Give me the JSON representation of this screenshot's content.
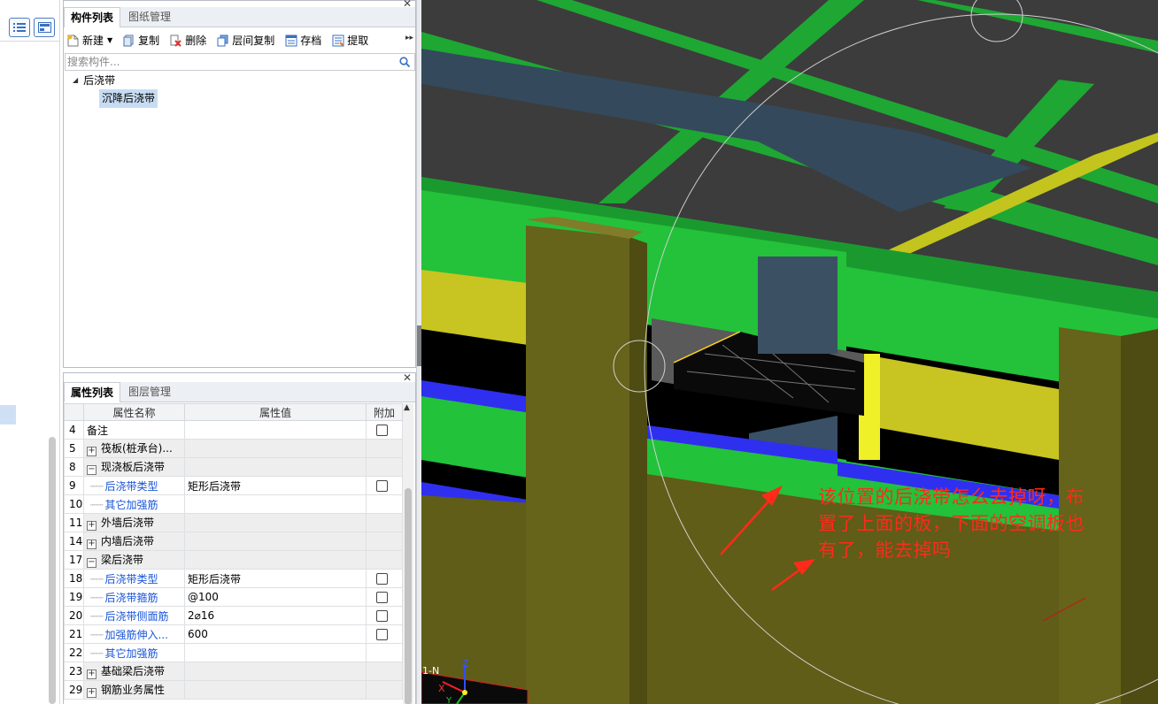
{
  "component_panel": {
    "tabs": [
      "构件列表",
      "图纸管理"
    ],
    "toolbar": {
      "new_label": "新建",
      "copy_label": "复制",
      "delete_label": "删除",
      "floor_copy_label": "层间复制",
      "archive_label": "存档",
      "extract_label": "提取"
    },
    "search_placeholder": "搜索构件...",
    "tree": {
      "root": "后浇带",
      "child": "沉降后浇带"
    }
  },
  "property_panel": {
    "tabs": [
      "属性列表",
      "图层管理"
    ],
    "columns": {
      "name": "属性名称",
      "value": "属性值",
      "extra": "附加"
    },
    "rows": [
      {
        "num": "4",
        "name": "备注",
        "value": "",
        "check": true,
        "level": "top",
        "toggle": ""
      },
      {
        "num": "5",
        "name": "筏板(桩承台)...",
        "value": "",
        "check": false,
        "level": "group",
        "toggle": "+"
      },
      {
        "num": "8",
        "name": "现浇板后浇带",
        "value": "",
        "check": false,
        "level": "group",
        "toggle": "−"
      },
      {
        "num": "9",
        "name": "后浇带类型",
        "value": "矩形后浇带",
        "check": true,
        "level": "sub",
        "toggle": ""
      },
      {
        "num": "10",
        "name": "其它加强筋",
        "value": "",
        "check": false,
        "level": "sub",
        "toggle": ""
      },
      {
        "num": "11",
        "name": "外墙后浇带",
        "value": "",
        "check": false,
        "level": "group",
        "toggle": "+"
      },
      {
        "num": "14",
        "name": "内墙后浇带",
        "value": "",
        "check": false,
        "level": "group",
        "toggle": "+"
      },
      {
        "num": "17",
        "name": "梁后浇带",
        "value": "",
        "check": false,
        "level": "group",
        "toggle": "−"
      },
      {
        "num": "18",
        "name": "后浇带类型",
        "value": "矩形后浇带",
        "check": true,
        "level": "sub",
        "toggle": ""
      },
      {
        "num": "19",
        "name": "后浇带箍筋",
        "value": "@100",
        "check": true,
        "level": "sub",
        "toggle": ""
      },
      {
        "num": "20",
        "name": "后浇带侧面筋",
        "value": "2⌀16",
        "check": true,
        "level": "sub",
        "toggle": ""
      },
      {
        "num": "21",
        "name": "加强筋伸入...",
        "value": "600",
        "check": true,
        "level": "sub",
        "toggle": ""
      },
      {
        "num": "22",
        "name": "其它加强筋",
        "value": "",
        "check": false,
        "level": "sub",
        "toggle": ""
      },
      {
        "num": "23",
        "name": "基础梁后浇带",
        "value": "",
        "check": false,
        "level": "group",
        "toggle": "+"
      },
      {
        "num": "29",
        "name": "钢筋业务属性",
        "value": "",
        "check": false,
        "level": "group",
        "toggle": "+"
      }
    ]
  },
  "viewport": {
    "axis_labels": {
      "z": "Z",
      "x": "X",
      "y": "Y",
      "floor": "1-N"
    },
    "annotation_lines": [
      "该位置的后浇带怎么去掉呀，布",
      "置了上面的板，下面的空调板也",
      "有了，能去掉吗"
    ],
    "colors": {
      "background": "#000000",
      "slab": "#3d3d3d",
      "beam_green": "#22c43a",
      "post_cast_strip": "#3a5066",
      "column_olive": "#66631a",
      "yellow": "#eaea22",
      "blue_rebar": "#3030f0",
      "annotation_red": "#ff2a1a"
    }
  }
}
